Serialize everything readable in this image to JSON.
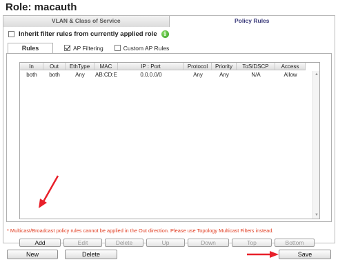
{
  "role": {
    "title": "Role: macauth"
  },
  "tabs": [
    {
      "label": "VLAN & Class of Service",
      "active": false
    },
    {
      "label": "Policy Rules",
      "active": true
    }
  ],
  "inherit": {
    "label": "Inherit filter rules from currently applied role",
    "checked": false,
    "info_icon": "info-icon"
  },
  "inner_tab": {
    "label": "Rules"
  },
  "options": {
    "ap_filtering": {
      "label": "AP Filtering",
      "checked": true
    },
    "custom_ap_rules": {
      "label": "Custom AP Rules",
      "checked": false
    }
  },
  "table": {
    "columns": [
      "In",
      "Out",
      "EthType",
      "MAC",
      "IP : Port",
      "Protocol",
      "Priority",
      "ToS/DSCP",
      "Access"
    ],
    "rows": [
      [
        "both",
        "both",
        "Any",
        "AB:CD:E",
        "0.0.0.0/0",
        "Any",
        "Any",
        "N/A",
        "Allow"
      ]
    ]
  },
  "buttons": {
    "add": "Add",
    "edit": "Edit",
    "delete": "Delete",
    "up": "Up",
    "down": "Down",
    "top": "Top",
    "bottom": "Bottom"
  },
  "note": "* Multicast/Broadcast policy rules cannot be applied in the Out direction. Please use Topology Multicast Filters instead.",
  "footer": {
    "new": "New",
    "delete": "Delete",
    "save": "Save"
  },
  "colors": {
    "arrow": "#e8202a",
    "note": "#e03a1e",
    "active_tab_text": "#3a3a7a"
  }
}
